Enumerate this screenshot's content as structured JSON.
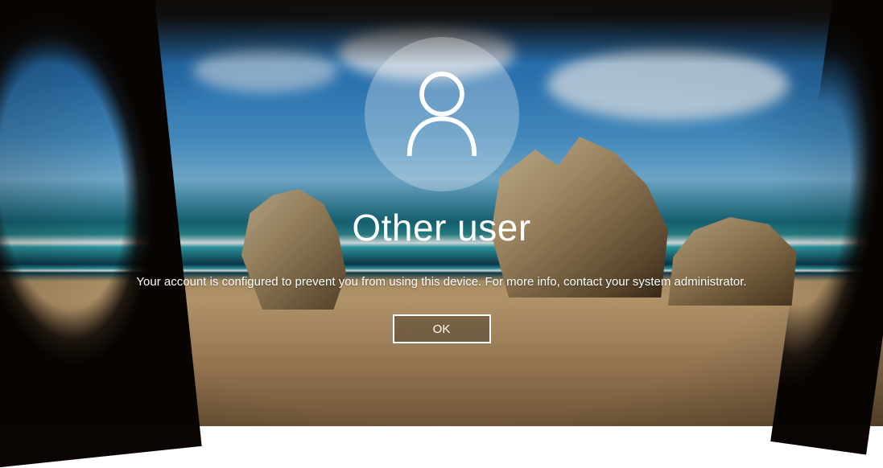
{
  "profile": {
    "display_name": "Other user",
    "icon": "user-outline-icon"
  },
  "message": "Your account is configured to prevent you from using this device. For more info, contact your system administrator.",
  "buttons": {
    "ok_label": "OK"
  }
}
